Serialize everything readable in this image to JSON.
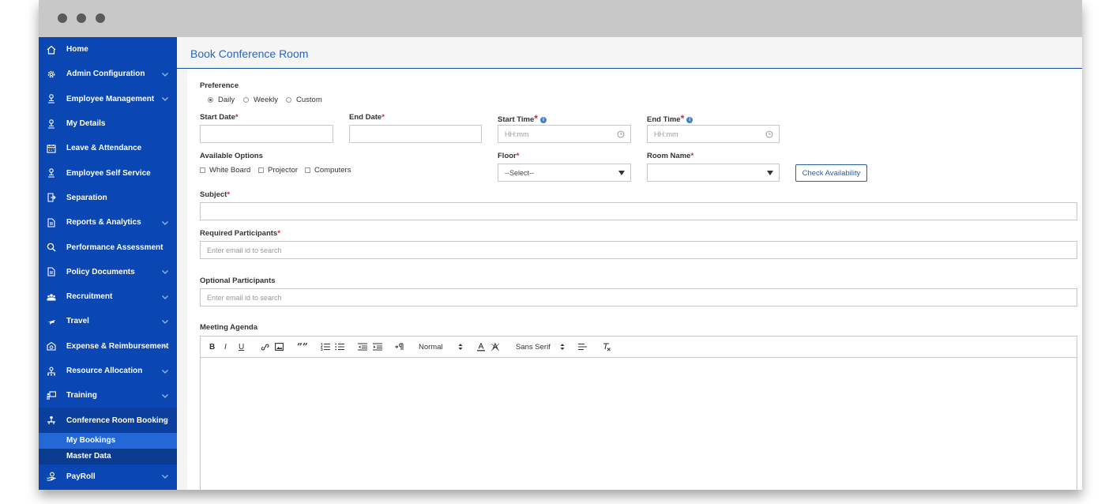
{
  "window": {
    "controls": [
      "close",
      "minimize",
      "maximize"
    ]
  },
  "sidebar": {
    "items": [
      {
        "label": "Home",
        "icon": "home-icon",
        "expandable": false
      },
      {
        "label": "Admin Configuration",
        "icon": "gear-icon",
        "expandable": true
      },
      {
        "label": "Employee Management",
        "icon": "person-icon",
        "expandable": true
      },
      {
        "label": "My Details",
        "icon": "person-icon",
        "expandable": false
      },
      {
        "label": "Leave & Attendance",
        "icon": "calendar-icon",
        "expandable": false
      },
      {
        "label": "Employee Self Service",
        "icon": "person-icon",
        "expandable": false
      },
      {
        "label": "Separation",
        "icon": "exit-icon",
        "expandable": false
      },
      {
        "label": "Reports & Analytics",
        "icon": "document-icon",
        "expandable": true
      },
      {
        "label": "Performance Assessment",
        "icon": "magnifier-icon",
        "expandable": false
      },
      {
        "label": "Policy Documents",
        "icon": "document-icon",
        "expandable": true
      },
      {
        "label": "Recruitment",
        "icon": "group-icon",
        "expandable": true
      },
      {
        "label": "Travel",
        "icon": "plane-icon",
        "expandable": true
      },
      {
        "label": "Expense & Reimbursement",
        "icon": "money-icon",
        "expandable": true
      },
      {
        "label": "Resource Allocation",
        "icon": "network-icon",
        "expandable": true
      },
      {
        "label": "Training",
        "icon": "training-icon",
        "expandable": true
      },
      {
        "label": "Conference Room Booking",
        "icon": "conference-icon",
        "expandable": true
      }
    ],
    "sub_items": [
      {
        "label": "My Bookings",
        "selected": true
      },
      {
        "label": "Master Data",
        "selected": false
      }
    ],
    "after": {
      "label": "PayRoll",
      "icon": "payroll-icon",
      "expandable": true
    }
  },
  "page": {
    "title": "Book Conference Room"
  },
  "form": {
    "preference_label": "Preference",
    "preference_options": [
      "Daily",
      "Weekly",
      "Custom"
    ],
    "preference_selected": "Daily",
    "start_date_label": "Start Date",
    "end_date_label": "End Date",
    "start_time_label": "Start Time",
    "end_time_label": "End Time",
    "time_placeholder": "HH:mm",
    "available_options_label": "Available Options",
    "available_options": [
      "White Board",
      "Projector",
      "Computers"
    ],
    "floor_label": "Floor",
    "floor_value": "--Select--",
    "room_name_label": "Room Name",
    "room_name_value": "",
    "check_button": "Check Availability",
    "subject_label": "Subject",
    "required_participants_label": "Required Participants",
    "optional_participants_label": "Optional Participants",
    "participants_placeholder": "Enter email id to search",
    "agenda_label": "Meeting Agenda",
    "required_marker": "*"
  },
  "editor": {
    "format_value": "Normal",
    "font_value": "Sans Serif",
    "bold": "B",
    "italic": "I",
    "underline": "U",
    "quote": "””"
  },
  "colors": {
    "sidebar": "#0b47b3",
    "sidebar_selected": "#2368d6",
    "accent": "#2a67b9",
    "required": "#d9232d"
  }
}
